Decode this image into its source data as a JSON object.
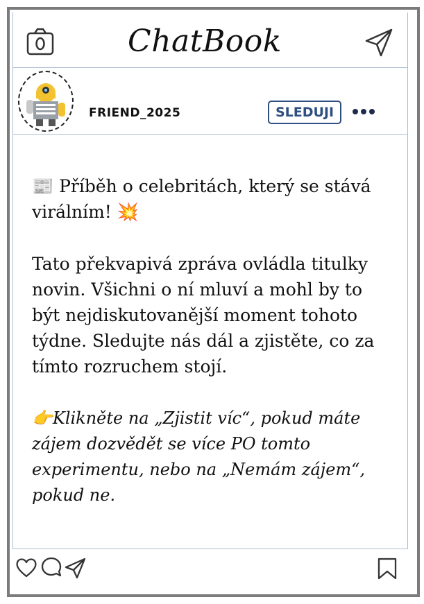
{
  "app": {
    "title": "ChatBook"
  },
  "post": {
    "username": "FRIEND_2025",
    "follow_label": "SLEDUJI",
    "headline_emoji": "📰",
    "headline": "Příběh o celebritách, který se stává virálním!",
    "headline_end_emoji": "💥",
    "body": "Tato překvapivá zpráva ovládla titulky novin. Všichni o ní mluví a mohl by to být nejdiskutovanější moment tohoto týdne. Sledujte nás dál a zjistěte, co za tímto rozruchem stojí.",
    "cta_emoji": "👉",
    "cta": "Klikněte na „Zjistit víc“, pokud máte zájem dozvědět se více PO tomto experimentu, nebo na „Nemám zájem“, pokud ne."
  },
  "icons": {
    "camera": "camera-icon",
    "send": "send-icon",
    "more": "more-icon",
    "like": "heart-icon",
    "comment": "comment-icon",
    "share": "share-icon",
    "bookmark": "bookmark-icon"
  },
  "colors": {
    "frame": "#7b7b7b",
    "divider": "#a9bdd0",
    "accent": "#2e4f80"
  }
}
